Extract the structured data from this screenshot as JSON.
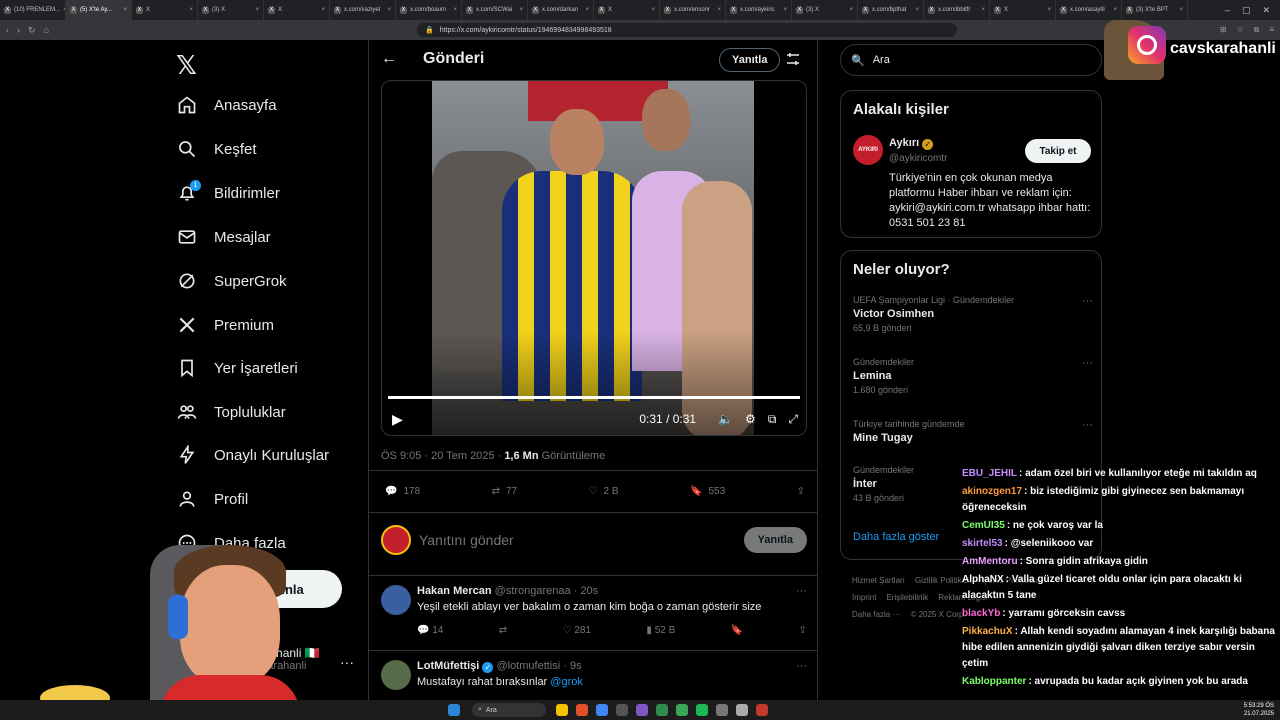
{
  "browser": {
    "tabs": [
      {
        "label": "(10) FRENLEM...",
        "active": false
      },
      {
        "label": "(5) X'te Ay...",
        "active": true
      },
      {
        "label": "X",
        "active": false
      },
      {
        "label": "(3) X",
        "active": false
      },
      {
        "label": "X",
        "active": false
      },
      {
        "label": "x.com/vaziyet",
        "active": false
      },
      {
        "label": "x.com/boaum",
        "active": false
      },
      {
        "label": "x.com/SCWai",
        "active": false
      },
      {
        "label": "x.com/darkan",
        "active": false
      },
      {
        "label": "X",
        "active": false
      },
      {
        "label": "x.com/ensonr",
        "active": false
      },
      {
        "label": "x.com/aykiric",
        "active": false
      },
      {
        "label": "(3) X",
        "active": false
      },
      {
        "label": "x.com/bpthat",
        "active": false
      },
      {
        "label": "x.com/ibbitfr",
        "active": false
      },
      {
        "label": "X",
        "active": false
      },
      {
        "label": "x.com/asayiti",
        "active": false
      },
      {
        "label": "(3) X'te BPT",
        "active": false
      }
    ],
    "url": "https://x.com/aykiricomtr/status/1946994834998493518"
  },
  "left_nav": {
    "items": [
      {
        "label": "Anasayfa",
        "icon": "home-icon"
      },
      {
        "label": "Keşfet",
        "icon": "search-icon"
      },
      {
        "label": "Bildirimler",
        "icon": "bell-icon",
        "badge": "1"
      },
      {
        "label": "Mesajlar",
        "icon": "mail-icon"
      },
      {
        "label": "SuperGrok",
        "icon": "grok-icon"
      },
      {
        "label": "Premium",
        "icon": "x-icon"
      },
      {
        "label": "Yer İşaretleri",
        "icon": "bookmark-icon"
      },
      {
        "label": "Topluluklar",
        "icon": "communities-icon"
      },
      {
        "label": "Onaylı Kuruluşlar",
        "icon": "lightning-icon"
      },
      {
        "label": "Profil",
        "icon": "person-icon"
      },
      {
        "label": "Daha fazla",
        "icon": "more-circle-icon"
      }
    ],
    "post_button": "Gönderi yayınla",
    "account_name": "cavskarahanli 🇮🇹",
    "account_handle": "@cavskarahanli"
  },
  "center": {
    "title": "Gönderi",
    "reply_button": "Yanıtla",
    "video": {
      "time": "0:31 / 0:31",
      "progress": 1.0
    },
    "meta_time": "ÖS 9:05 · 20 Tem 2025 · ",
    "meta_views": "1,6 Mn",
    "meta_views_label": " Görüntüleme",
    "stats": {
      "replies": "178",
      "reposts": "77",
      "likes": "2 B",
      "bookmarks": "553"
    },
    "composer_placeholder": "Yanıtını gönder",
    "composer_button": "Yanıtla",
    "replies": [
      {
        "name": "Hakan Mercan",
        "handle": "@strongarenaa",
        "time": "· 20s",
        "text": "Yeşil etekli ablayı ver bakalım o zaman kim boğa o zaman gösterir size",
        "replies": "14",
        "reposts": "",
        "likes": "281",
        "views": "52 B",
        "avatar_color": "#3a5fa0"
      },
      {
        "name": "LotMüfettişi",
        "handle": "@lotmufettisi",
        "time": "· 9s",
        "text": "Mustafayı rahat bıraksınlar ",
        "mention": "@grok",
        "avatar_color": "#556b4a"
      }
    ]
  },
  "right": {
    "search_placeholder": "Ara",
    "related": {
      "title": "Alakalı kişiler",
      "avatar_text": "AYKIRI",
      "name": "Aykırı",
      "handle": "@aykiricomtr",
      "follow_label": "Takip et",
      "bio": "Türkiye'nin en çok okunan medya platformu Haber ihbarı ve reklam için: aykiri@aykiri.com.tr whatsapp ihbar hattı: 0531 501 23 81"
    },
    "trends_title": "Neler oluyor?",
    "trends": [
      {
        "category": "UEFA Şampiyonlar Ligi · Gündemdekiler",
        "name": "Victor Osimhen",
        "count": "65,9 B gönderi"
      },
      {
        "category": "Gündemdekiler",
        "name": "Lemina",
        "count": "1.680 gönderi"
      },
      {
        "category": "Türkiye tarihinde gündemde",
        "name": "Mine Tugay",
        "count": ""
      },
      {
        "category": "Gündemdekiler",
        "name": "İnter",
        "count": "43 B gönderi"
      }
    ],
    "show_more": "Daha fazla göster",
    "footer": [
      "Hizmet Şartları",
      "Gizlilik Politikası",
      "Çerez Politikası",
      "Imprint",
      "Erişilebilirlik",
      "Reklam bilgisi",
      "Daha fazla ···",
      "© 2025 X Corp."
    ]
  },
  "overlay": {
    "instagram_handle": "cavskarahanli",
    "chat": [
      {
        "user": "EBU_JEHIL",
        "color": "#c58cff",
        "text": ": adam özel biri ve kullanılıyor eteğe mi takıldın aq"
      },
      {
        "user": "akinozgen17",
        "color": "#ff9a3c",
        "text": ": biz istediğimiz gibi giyinecez sen bakmamayı öğreneceksin"
      },
      {
        "user": "CemUI35",
        "color": "#7dff6a",
        "text": ": ne çok varoş var la"
      },
      {
        "user": "skirtel53",
        "color": "#c58cff",
        "text": ": @seleniikooo var"
      },
      {
        "user": "AmMentoru",
        "color": "#e8a0ff",
        "text": ": Sonra gidin afrikaya gidin"
      },
      {
        "user": "AlphaNX",
        "color": "#ffffff",
        "text": ": Valla güzel ticaret oldu onlar için para olacaktı ki alacaktın 5 tane"
      },
      {
        "user": "blackYb",
        "color": "#ff6ad5",
        "text": ": yarramı görceksin cavss"
      },
      {
        "user": "PikkachuX",
        "color": "#ffb14a",
        "text": ": Allah kendi soyadını alamayan 4 inek karşılığı babana hibe edilen annenizin giydiği şalvarı diken terziye sabır versin çetim"
      },
      {
        "user": "Kabloppanter",
        "color": "#7dff6a",
        "text": ": avrupada bu kadar açık giyinen yok bu arada"
      }
    ]
  },
  "taskbar": {
    "search": "Ara",
    "time": "5:53:29 ÖS",
    "date": "21.07.2025"
  }
}
